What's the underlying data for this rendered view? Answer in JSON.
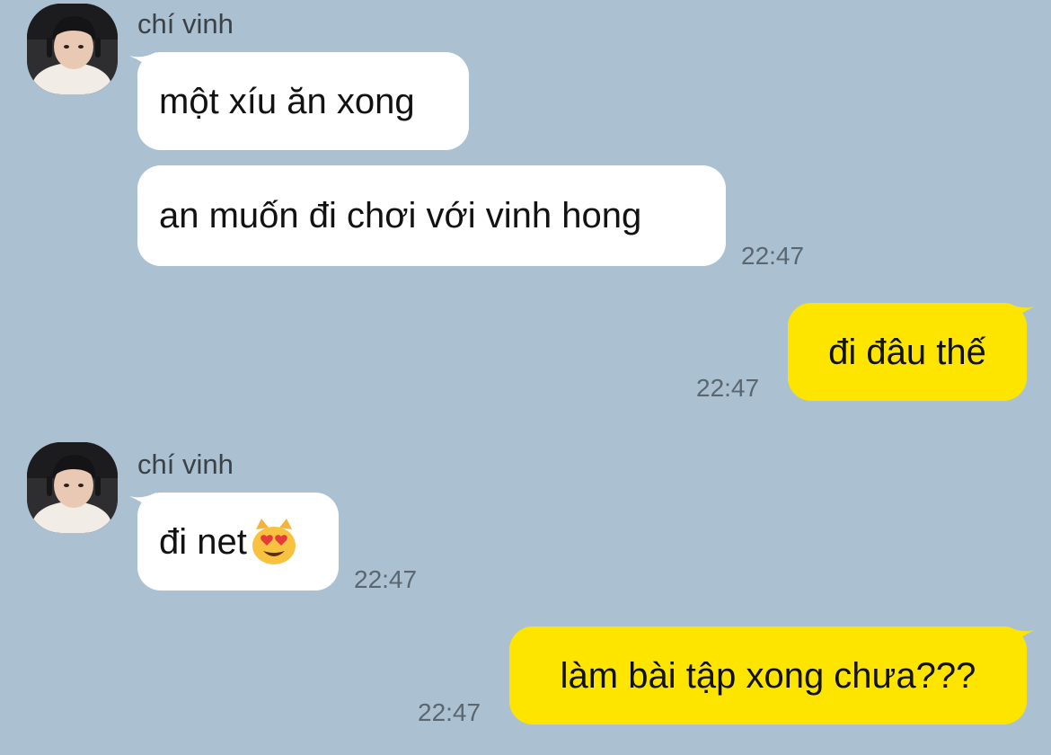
{
  "chat": {
    "background": "#abc1d1",
    "incoming_bubble_color": "#ffffff",
    "outgoing_bubble_color": "#fee500",
    "messages": [
      {
        "sender": "chí vinh",
        "text": "một xíu ăn xong"
      },
      {
        "text": "an muốn đi chơi với vinh hong",
        "time": "22:47"
      },
      {
        "text": "đi đâu thế",
        "time": "22:47"
      },
      {
        "sender": "chí vinh",
        "text": "đi net",
        "emoji_icon": "smiling-cat-heart-eyes-icon",
        "time": "22:47"
      },
      {
        "text": "làm bài tập xong chưa???",
        "time": "22:47"
      }
    ]
  }
}
